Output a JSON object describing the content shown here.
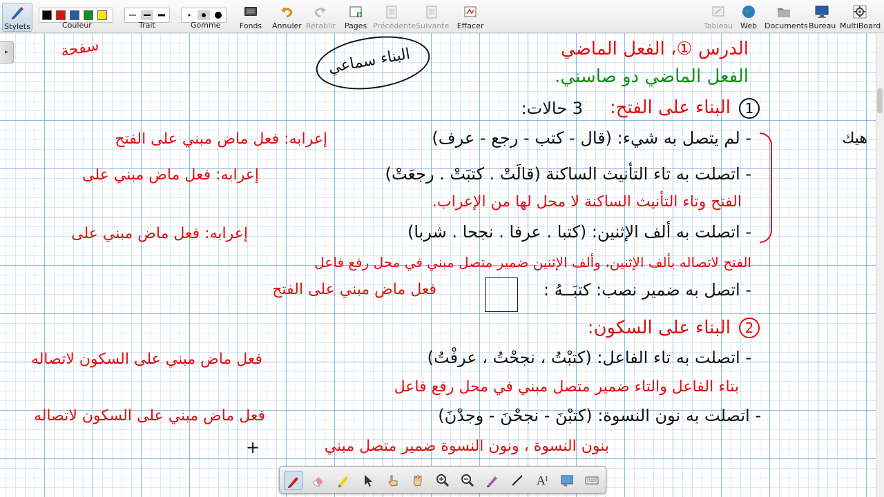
{
  "toolbar": {
    "stylets": "Stylets",
    "couleur": "Couleur",
    "trait": "Trait",
    "gomme": "Gomme",
    "fonds": "Fonds",
    "annuler": "Annuler",
    "retablir": "Rétablir",
    "pages": "Pages",
    "precedente": "Précédente",
    "suivante": "Suivante",
    "effacer": "Effacer",
    "tableau": "Tableau",
    "web": "Web",
    "documents": "Documents",
    "bureau": "Bureau",
    "multiboard": "MultiBoard",
    "colors": [
      "#000000",
      "#e01010",
      "#1a5fa8",
      "#14901a",
      "#f2e600"
    ]
  },
  "notes": {
    "corner": "سفحة",
    "cloud_title": "البناء سماعي",
    "lesson_title": "الدرس ①، الفعل الماضي",
    "subtitle": "الفعل الماضي دو صاسني.",
    "section1_num": "1",
    "section1": "البناء على الفتح:",
    "section1_tail": "3 حالات:",
    "l1": "- لم يتصل به شيء: (قال - كتب - رجع - عرف)",
    "l1_red": "إعرابه: فعل ماض مبني على الفتح",
    "l2": "- اتصلت به تاء التأنيث الساكنة (قالَتْ . كتبَتْ . رجعَتْ)",
    "l2_red": "إعرابه: فعل ماض مبني على",
    "l2b_red": "الفتح وتاء التأنيث الساكنة لا محل لها من الإعراب.",
    "l3": "- اتصلت به ألف الإثنين: (كتبا . عرفا . نجحا . شربا)",
    "l3_red": "إعرابه: فعل ماض مبني على",
    "l3b_red": "الفتح لاتصاله بألف الإثنين، وألف الإثنين ضمير متصل مبني في محل رفع فاعل",
    "l4": "- اتصل به ضمير نصب: كتبَــهُ :",
    "l4_red": "فعل ماض مبني على الفتح",
    "section2_num": "2",
    "section2": "البناء على السكون:",
    "l5": "- اتصلت به تاء الفاعل: (كتبْتُ ، نجحْتُ ، عرفْتُ)",
    "l5_red": "فعل ماض مبني على السكون لاتصاله",
    "l5b_red": "بتاء الفاعل والتاء ضمير متصل مبني في محل رفع فاعل",
    "l6": "- اتصلت به نون النسوة: (كتبْنَ - نجحْنَ - وجدْنَ)",
    "l6_red": "فعل ماض مبني على السكون لاتصاله",
    "l6b_red": "بنون النسوة ، ونون النسوة ضمير متصل مبني",
    "side_black": "هيك"
  }
}
